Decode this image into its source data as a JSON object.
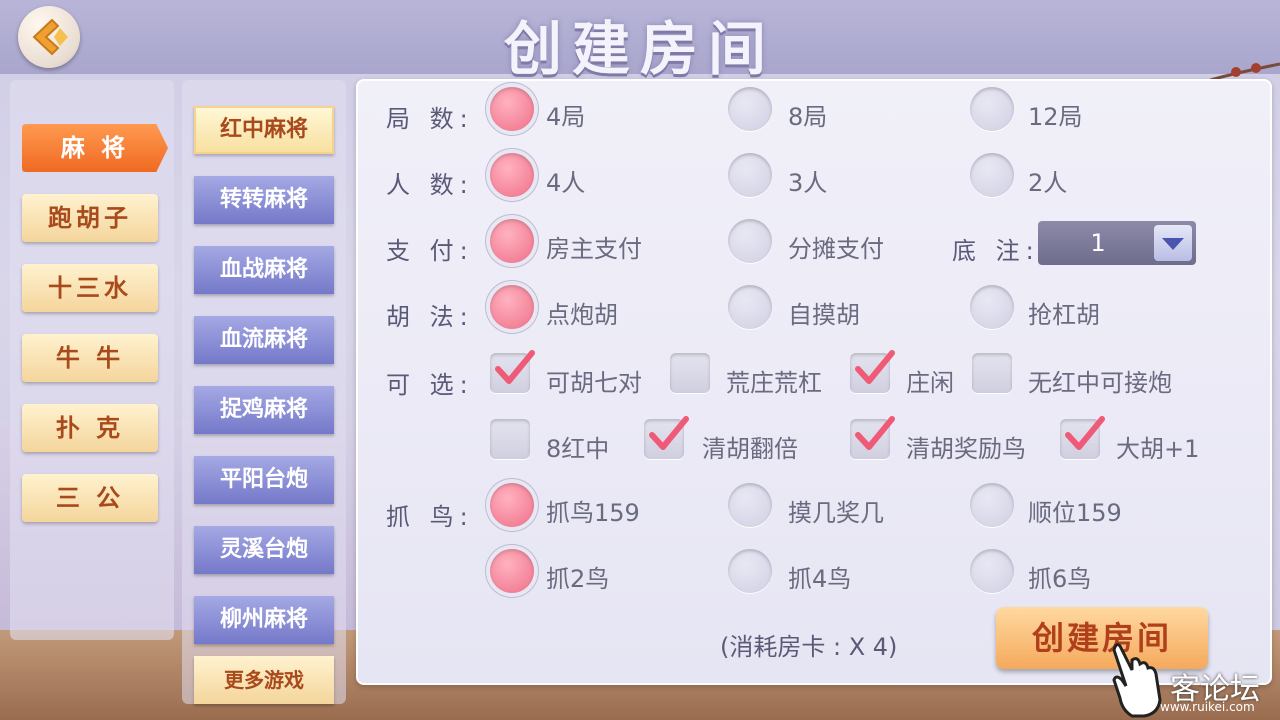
{
  "header": {
    "title": "创建房间"
  },
  "categories": [
    "麻 将",
    "跑胡子",
    "十三水",
    "牛 牛",
    "扑 克",
    "三 公"
  ],
  "games": [
    "红中麻将",
    "转转麻将",
    "血战麻将",
    "血流麻将",
    "捉鸡麻将",
    "平阳台炮",
    "灵溪台炮",
    "柳州麻将",
    "更多游戏"
  ],
  "form": {
    "rounds": {
      "label": "局 数:",
      "options": [
        "4局",
        "8局",
        "12局"
      ],
      "selected": "4局"
    },
    "players": {
      "label": "人 数:",
      "options": [
        "4人",
        "3人",
        "2人"
      ],
      "selected": "4人"
    },
    "payment": {
      "label": "支 付:",
      "options": [
        "房主支付",
        "分摊支付"
      ],
      "selected": "房主支付"
    },
    "base_bet": {
      "label": "底 注:",
      "value": "1"
    },
    "win_type": {
      "label": "胡 法:",
      "options": [
        "点炮胡",
        "自摸胡",
        "抢杠胡"
      ],
      "selected": "点炮胡"
    },
    "optional": {
      "label": "可 选:",
      "row1": [
        {
          "text": "可胡七对",
          "checked": true
        },
        {
          "text": "荒庄荒杠",
          "checked": false
        },
        {
          "text": "庄闲",
          "checked": true
        },
        {
          "text": "无红中可接炮",
          "checked": false
        }
      ],
      "row2": [
        {
          "text": "8红中",
          "checked": false
        },
        {
          "text": "清胡翻倍",
          "checked": true
        },
        {
          "text": "清胡奖励鸟",
          "checked": true
        },
        {
          "text": "大胡+1",
          "checked": true
        }
      ]
    },
    "birds": {
      "label": "抓 鸟:",
      "row1": [
        "抓鸟159",
        "摸几奖几",
        "顺位159"
      ],
      "row1_selected": "抓鸟159",
      "row2": [
        "抓2鸟",
        "抓4鸟",
        "抓6鸟"
      ],
      "row2_selected": "抓2鸟"
    },
    "cost": "(消耗房卡 : X 4)",
    "create_button": "创建房间"
  },
  "watermark": {
    "text": "客论坛",
    "url": "www.ruikei.com"
  },
  "colors": {
    "accent_orange": "#f06a22",
    "radio_on": "#ef6f88",
    "game_tab": "#7479c9"
  }
}
